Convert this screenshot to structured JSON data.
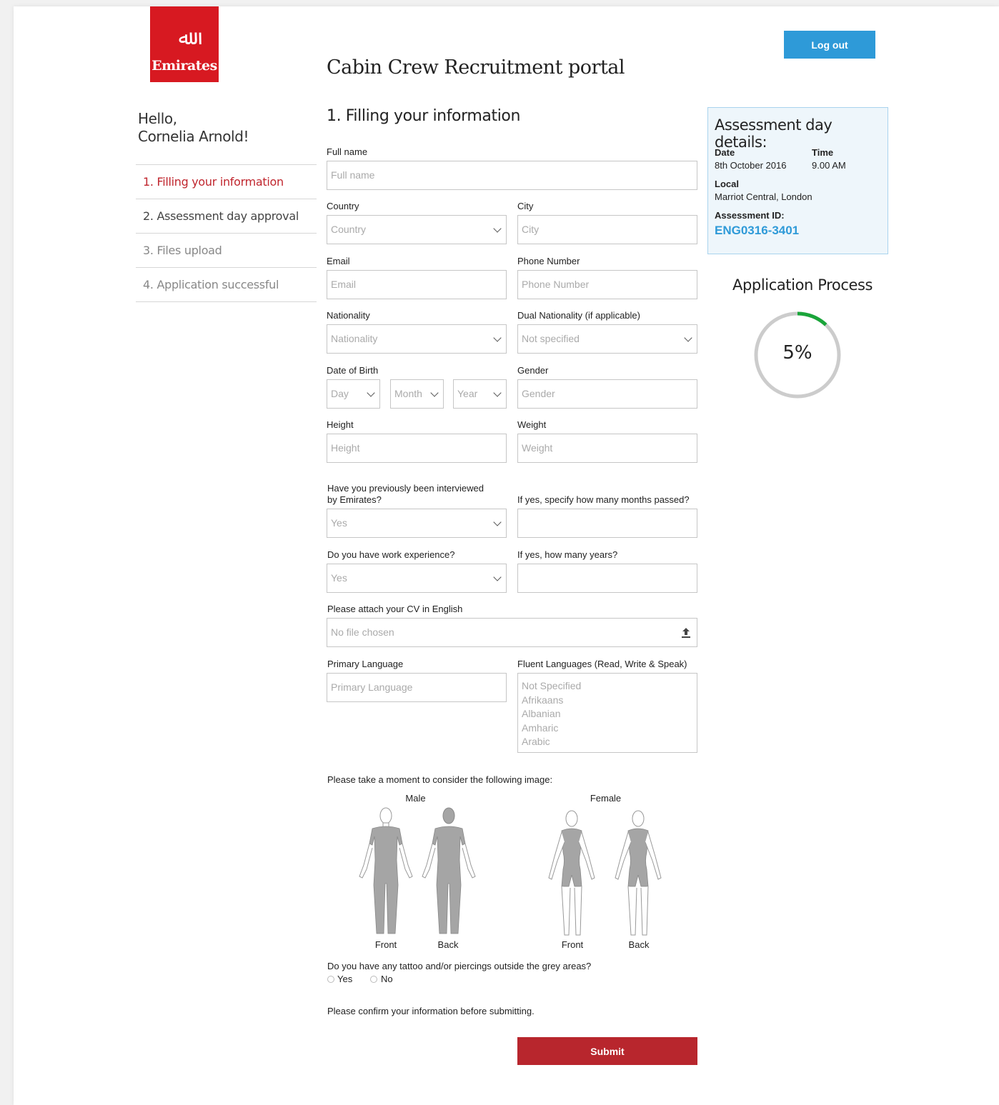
{
  "logo": {
    "word": "Emirates",
    "mark": "ﷲ"
  },
  "header": {
    "portal_title": "Cabin Crew Recruitment portal",
    "logout_label": "Log out"
  },
  "greeting": {
    "line1": "Hello,",
    "line2": "Cornelia Arnold!"
  },
  "steps": [
    {
      "label": "1. Filling your information"
    },
    {
      "label": "2. Assessment day approval"
    },
    {
      "label": "3. Files upload"
    },
    {
      "label": "4. Application successful"
    }
  ],
  "form": {
    "title": "1. Filling your information",
    "full_name": {
      "label": "Full name",
      "placeholder": "Full name"
    },
    "country": {
      "label": "Country",
      "placeholder": "Country"
    },
    "city": {
      "label": "City",
      "placeholder": "City"
    },
    "email": {
      "label": "Email",
      "placeholder": "Email"
    },
    "phone": {
      "label": "Phone Number",
      "placeholder": "Phone Number"
    },
    "nationality": {
      "label": "Nationality",
      "placeholder": "Nationality"
    },
    "dual_nationality": {
      "label": "Dual Nationality (if applicable)",
      "value": "Not specified"
    },
    "dob": {
      "label": "Date of Birth",
      "day": "Day",
      "month": "Month",
      "year": "Year"
    },
    "gender": {
      "label": "Gender",
      "placeholder": "Gender"
    },
    "height": {
      "label": "Height",
      "placeholder": "Height"
    },
    "weight": {
      "label": "Weight",
      "placeholder": "Weight"
    },
    "interviewed": {
      "label_line1": "Have you previously been interviewed",
      "label_line2": "by Emirates?",
      "value": "Yes"
    },
    "months_passed": {
      "label": "If yes, specify how many months passed?",
      "value": ""
    },
    "work_experience": {
      "label": "Do you have work experience?",
      "value": "Yes"
    },
    "years": {
      "label": "If yes, how many years?",
      "value": ""
    },
    "cv": {
      "label": "Please attach your CV in English",
      "value": "No file chosen"
    },
    "primary_language": {
      "label": "Primary Language",
      "placeholder": "Primary Language"
    },
    "fluent_languages": {
      "label": "Fluent Languages (Read, Write & Speak)",
      "options": [
        "Not Specified",
        "Afrikaans",
        "Albanian",
        "Amharic",
        "Arabic"
      ]
    },
    "image_prompt": "Please take a moment to consider the following image:",
    "male_label": "Male",
    "female_label": "Female",
    "front_label": "Front",
    "back_label": "Back",
    "tattoo_question": "Do you have any tattoo and/or piercings outside the grey areas?",
    "yes_label": "Yes",
    "no_label": "No",
    "confirm_text": "Please confirm your information before submitting.",
    "submit_label": "Submit"
  },
  "assessment": {
    "title": "Assessment day details:",
    "date_label": "Date",
    "date_value": "8th October 2016",
    "time_label": "Time",
    "time_value": "9.00 AM",
    "local_label": "Local",
    "local_value": "Marriot Central, London",
    "id_label": "Assessment ID:",
    "id_value": "ENG0316-3401"
  },
  "progress": {
    "title": "Application Process",
    "label": "5%",
    "fraction": 0.05
  },
  "colors": {
    "brand_red": "#d71921",
    "accent_blue": "#2e9ad8",
    "submit_red": "#b8262d",
    "progress_green": "#1aa53a"
  }
}
